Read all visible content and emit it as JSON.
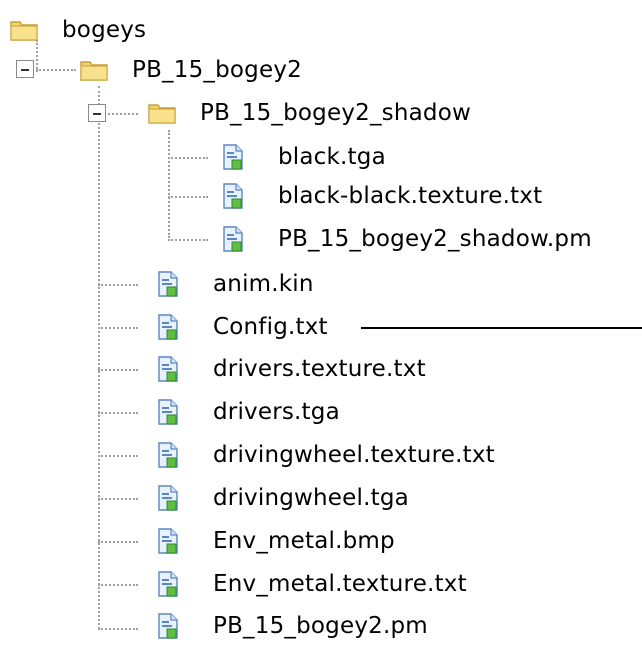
{
  "tree": {
    "root": {
      "label": "bogeys",
      "icon": "folder-icon",
      "children": [
        {
          "label": "PB_15_bogey2",
          "icon": "folder-icon",
          "children": [
            {
              "label": "PB_15_bogey2_shadow",
              "icon": "folder-icon",
              "children": [
                {
                  "label": "black.tga",
                  "icon": "file-icon"
                },
                {
                  "label": "black-black.texture.txt",
                  "icon": "file-icon"
                },
                {
                  "label": "PB_15_bogey2_shadow.pm",
                  "icon": "file-icon"
                }
              ]
            },
            {
              "label": "anim.kin",
              "icon": "file-icon"
            },
            {
              "label": "Config.txt",
              "icon": "file-icon"
            },
            {
              "label": "drivers.texture.txt",
              "icon": "file-icon"
            },
            {
              "label": "drivers.tga",
              "icon": "file-icon"
            },
            {
              "label": "drivingwheel.texture.txt",
              "icon": "file-icon"
            },
            {
              "label": "drivingwheel.tga",
              "icon": "file-icon"
            },
            {
              "label": "Env_metal.bmp",
              "icon": "file-icon"
            },
            {
              "label": "Env_metal.texture.txt",
              "icon": "file-icon"
            },
            {
              "label": "PB_15_bogey2.pm",
              "icon": "file-icon"
            }
          ]
        }
      ]
    }
  },
  "colors": {
    "folder_body": "#f1d26b",
    "folder_tab": "#f7e18d",
    "folder_outline": "#c9a038",
    "file_body": "#e8f2ff",
    "file_outline": "#5d86bf",
    "file_badge": "#5fbf45",
    "tree_lines": "#a0a0a0",
    "pointer_line": "#000000"
  }
}
